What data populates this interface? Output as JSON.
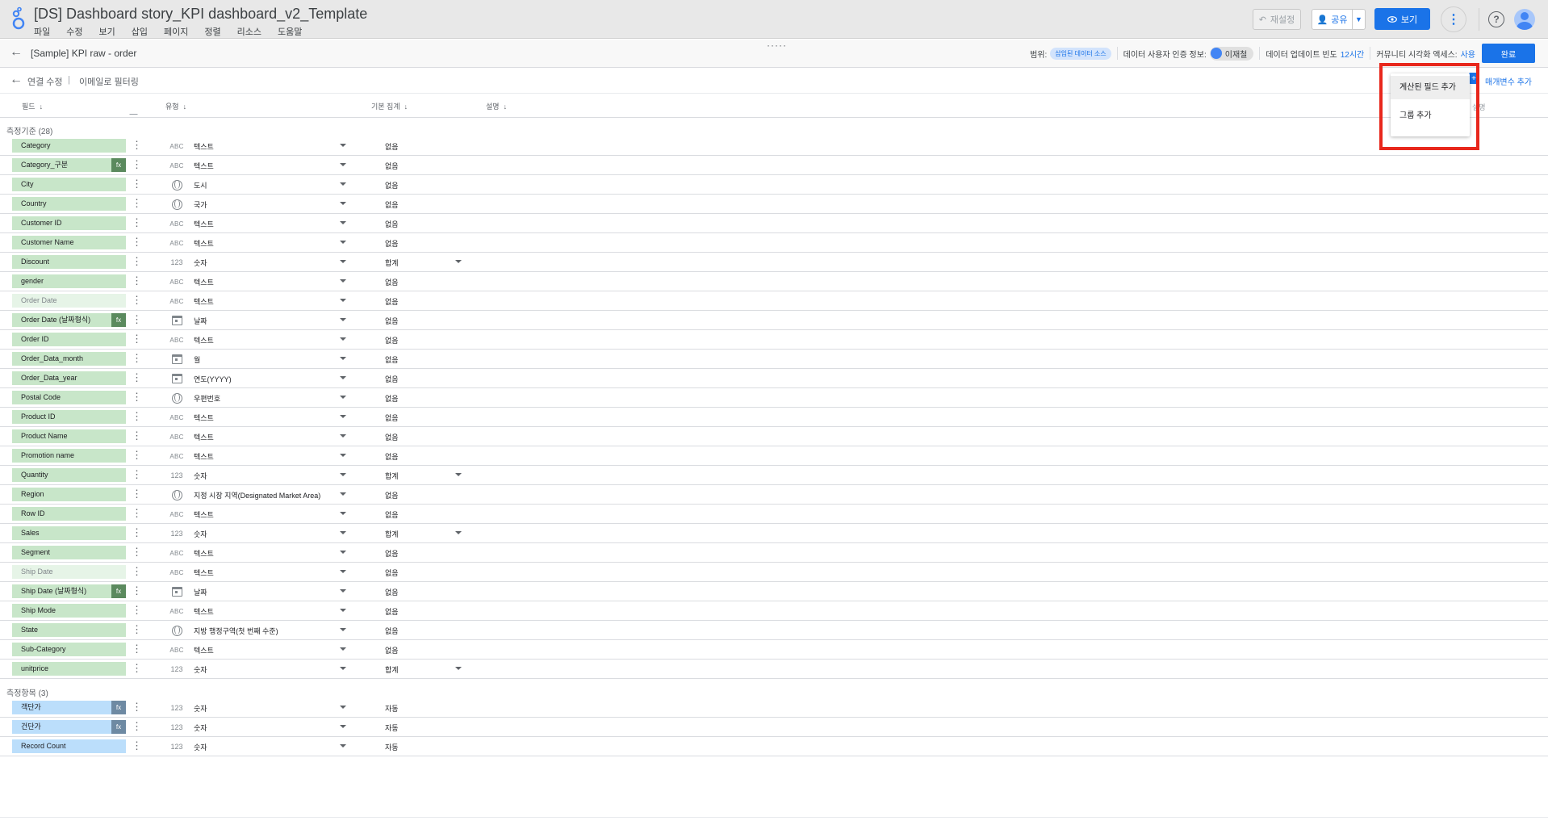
{
  "app": {
    "title": "[DS] Dashboard story_KPI dashboard_v2_Template",
    "menu": [
      "파일",
      "수정",
      "보기",
      "삽입",
      "페이지",
      "정렬",
      "리소스",
      "도움말"
    ],
    "reset_label": "재설정",
    "share_label": "공유",
    "view_label": "보기"
  },
  "datasource": {
    "name": "[Sample] KPI raw - order",
    "scope_label": "범위:",
    "scope_chip": "삽입된 데이터 소스",
    "credential_label": "데이터 사용자 인증 정보:",
    "credential_user": "이재철",
    "refresh_label": "데이터 업데이트 빈도",
    "refresh_value": "12시간",
    "community_label": "커뮤니티 시각화 액세스:",
    "community_value": "사용",
    "done_label": "완료"
  },
  "toolbar": {
    "edit_connection": "연결 수정",
    "separator": "|",
    "email_filter": "이메일로 필터링",
    "add_parameter": "매개변수 추가",
    "faint_label": "설명"
  },
  "columns": {
    "field": "필드",
    "type": "유형",
    "aggregation": "기본 집계",
    "description": "설명"
  },
  "dimensions_header": "측정기준 (28)",
  "metrics_header": "측정항목 (3)",
  "dimensions": [
    {
      "name": "Category",
      "type_icon": "ABC",
      "type": "텍스트",
      "agg": "없음",
      "fx": false,
      "grey": false,
      "agg_caret": false
    },
    {
      "name": "Category_구분",
      "type_icon": "ABC",
      "type": "텍스트",
      "agg": "없음",
      "fx": true,
      "grey": false,
      "agg_caret": false
    },
    {
      "name": "City",
      "type_icon": "globe",
      "type": "도시",
      "agg": "없음",
      "fx": false,
      "grey": false,
      "agg_caret": false
    },
    {
      "name": "Country",
      "type_icon": "globe",
      "type": "국가",
      "agg": "없음",
      "fx": false,
      "grey": false,
      "agg_caret": false
    },
    {
      "name": "Customer ID",
      "type_icon": "ABC",
      "type": "텍스트",
      "agg": "없음",
      "fx": false,
      "grey": false,
      "agg_caret": false
    },
    {
      "name": "Customer Name",
      "type_icon": "ABC",
      "type": "텍스트",
      "agg": "없음",
      "fx": false,
      "grey": false,
      "agg_caret": false
    },
    {
      "name": "Discount",
      "type_icon": "123",
      "type": "숫자",
      "agg": "합계",
      "fx": false,
      "grey": false,
      "agg_caret": true
    },
    {
      "name": "gender",
      "type_icon": "ABC",
      "type": "텍스트",
      "agg": "없음",
      "fx": false,
      "grey": false,
      "agg_caret": false
    },
    {
      "name": "Order Date",
      "type_icon": "ABC",
      "type": "텍스트",
      "agg": "없음",
      "fx": false,
      "grey": true,
      "agg_caret": false
    },
    {
      "name": "Order Date (날짜형식)",
      "type_icon": "calendar",
      "type": "날짜",
      "agg": "없음",
      "fx": true,
      "grey": false,
      "agg_caret": false
    },
    {
      "name": "Order ID",
      "type_icon": "ABC",
      "type": "텍스트",
      "agg": "없음",
      "fx": false,
      "grey": false,
      "agg_caret": false
    },
    {
      "name": "Order_Data_month",
      "type_icon": "calendar",
      "type": "월",
      "agg": "없음",
      "fx": false,
      "grey": false,
      "agg_caret": false
    },
    {
      "name": "Order_Data_year",
      "type_icon": "calendar",
      "type": "연도(YYYY)",
      "agg": "없음",
      "fx": false,
      "grey": false,
      "agg_caret": false
    },
    {
      "name": "Postal Code",
      "type_icon": "globe",
      "type": "우편번호",
      "agg": "없음",
      "fx": false,
      "grey": false,
      "agg_caret": false
    },
    {
      "name": "Product ID",
      "type_icon": "ABC",
      "type": "텍스트",
      "agg": "없음",
      "fx": false,
      "grey": false,
      "agg_caret": false
    },
    {
      "name": "Product Name",
      "type_icon": "ABC",
      "type": "텍스트",
      "agg": "없음",
      "fx": false,
      "grey": false,
      "agg_caret": false
    },
    {
      "name": "Promotion name",
      "type_icon": "ABC",
      "type": "텍스트",
      "agg": "없음",
      "fx": false,
      "grey": false,
      "agg_caret": false
    },
    {
      "name": "Quantity",
      "type_icon": "123",
      "type": "숫자",
      "agg": "합계",
      "fx": false,
      "grey": false,
      "agg_caret": true
    },
    {
      "name": "Region",
      "type_icon": "globe",
      "type": "지정 시장 지역(Designated Market Area)",
      "agg": "없음",
      "fx": false,
      "grey": false,
      "agg_caret": false
    },
    {
      "name": "Row ID",
      "type_icon": "ABC",
      "type": "텍스트",
      "agg": "없음",
      "fx": false,
      "grey": false,
      "agg_caret": false
    },
    {
      "name": "Sales",
      "type_icon": "123",
      "type": "숫자",
      "agg": "합계",
      "fx": false,
      "grey": false,
      "agg_caret": true
    },
    {
      "name": "Segment",
      "type_icon": "ABC",
      "type": "텍스트",
      "agg": "없음",
      "fx": false,
      "grey": false,
      "agg_caret": false
    },
    {
      "name": "Ship Date",
      "type_icon": "ABC",
      "type": "텍스트",
      "agg": "없음",
      "fx": false,
      "grey": true,
      "agg_caret": false
    },
    {
      "name": "Ship Date (날짜형식)",
      "type_icon": "calendar",
      "type": "날짜",
      "agg": "없음",
      "fx": true,
      "grey": false,
      "agg_caret": false
    },
    {
      "name": "Ship Mode",
      "type_icon": "ABC",
      "type": "텍스트",
      "agg": "없음",
      "fx": false,
      "grey": false,
      "agg_caret": false
    },
    {
      "name": "State",
      "type_icon": "globe",
      "type": "지방 행정구역(첫 번째 수준)",
      "agg": "없음",
      "fx": false,
      "grey": false,
      "agg_caret": false
    },
    {
      "name": "Sub-Category",
      "type_icon": "ABC",
      "type": "텍스트",
      "agg": "없음",
      "fx": false,
      "grey": false,
      "agg_caret": false
    },
    {
      "name": "unitprice",
      "type_icon": "123",
      "type": "숫자",
      "agg": "합계",
      "fx": false,
      "grey": false,
      "agg_caret": true
    }
  ],
  "metrics": [
    {
      "name": "객단가",
      "type_icon": "123",
      "type": "숫자",
      "agg": "자동",
      "fx": true
    },
    {
      "name": "건단가",
      "type_icon": "123",
      "type": "숫자",
      "agg": "자동",
      "fx": true
    },
    {
      "name": "Record Count",
      "type_icon": "123",
      "type": "숫자",
      "agg": "자동",
      "fx": false
    }
  ],
  "popup_menu": {
    "items": [
      "계산된 필드 추가",
      "그룹 추가"
    ]
  },
  "colors": {
    "accent": "#1a73e8",
    "dimension_pill": "#c8e6c9",
    "metric_pill": "#bbdefb",
    "highlight_box": "#e8271c"
  }
}
